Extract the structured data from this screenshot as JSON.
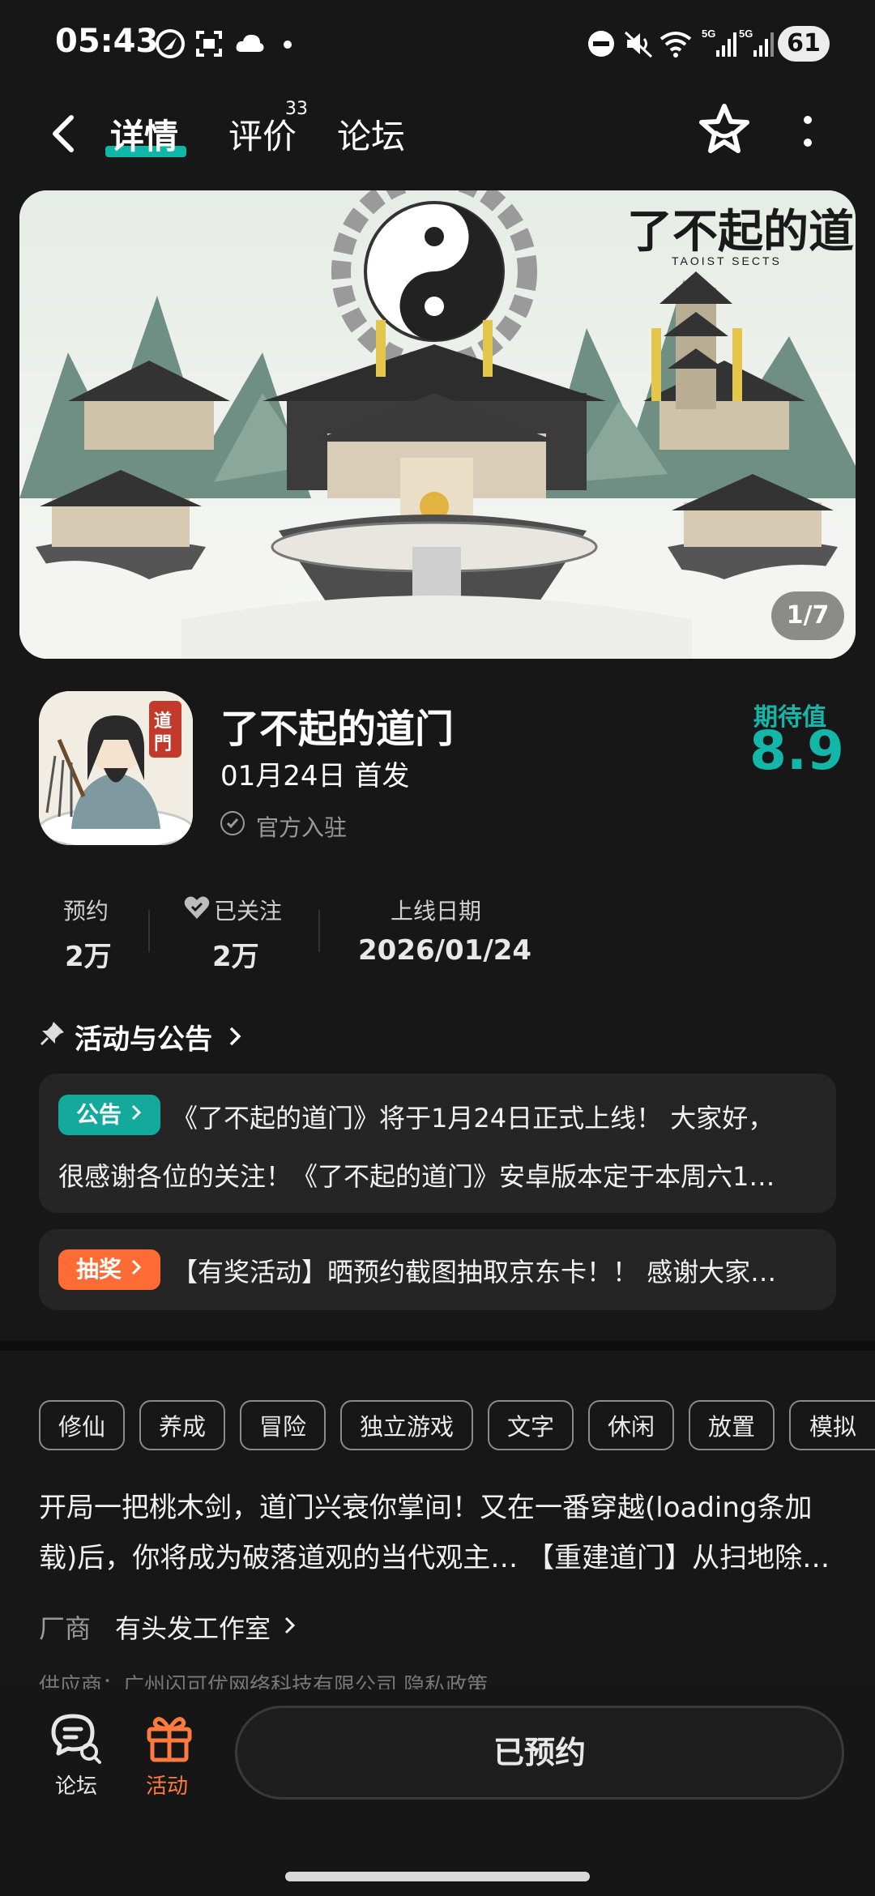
{
  "status_bar": {
    "time": "05:43",
    "battery": "61",
    "signal_labels": [
      "5G",
      "5G"
    ]
  },
  "nav": {
    "tabs": [
      {
        "label": "详情"
      },
      {
        "label": "评价"
      },
      {
        "label": "论坛"
      }
    ],
    "review_count": "33"
  },
  "banner": {
    "logo_text": "了不起的道门",
    "logo_subtext": "TAOIST SECTS",
    "page_indicator": "1/7"
  },
  "app": {
    "title": "了不起的道门",
    "release": "01月24日 首发",
    "official": "官方入驻",
    "icon_seal": "道門",
    "expect_label": "期待值",
    "expect_value": "8.9"
  },
  "stats": [
    {
      "label": "预约",
      "value": "2万"
    },
    {
      "label": "已关注",
      "value": "2万"
    },
    {
      "label": "上线日期",
      "value": "2026/01/24"
    }
  ],
  "activities": {
    "title": "活动与公告",
    "items": [
      {
        "badge": "公告",
        "text_line1": "《了不起的道门》将于1月24日正式上线！ 大家好，",
        "text_line2": "很感谢各位的关注！《了不起的道门》安卓版本定于本周六1…"
      },
      {
        "badge": "抽奖",
        "text_line1": "【有奖活动】晒预约截图抽取京东卡！！ 感谢大家…"
      }
    ]
  },
  "tags": [
    "修仙",
    "养成",
    "冒险",
    "独立游戏",
    "文字",
    "休闲",
    "放置",
    "模拟"
  ],
  "description": {
    "line1": "开局一把桃木剑，道门兴衰你掌间！又在一番穿越(loading条加",
    "line2": "载)后，你将成为破落道观的当代观主… 【重建道门】从扫地除…"
  },
  "vendor": {
    "label": "厂商",
    "name": "有头发工作室"
  },
  "supplier_text": "供应商：广州闪可优网络科技有限公司    隐私政策",
  "bottom_bar": {
    "forum_label": "论坛",
    "activity_label": "活动",
    "reserve_label": "已预约"
  },
  "colors": {
    "accent": "#13b7aa",
    "notice_badge": "#13a99c",
    "lottery_badge": "#ff6b35",
    "activity_orange": "#ff7a3d"
  }
}
